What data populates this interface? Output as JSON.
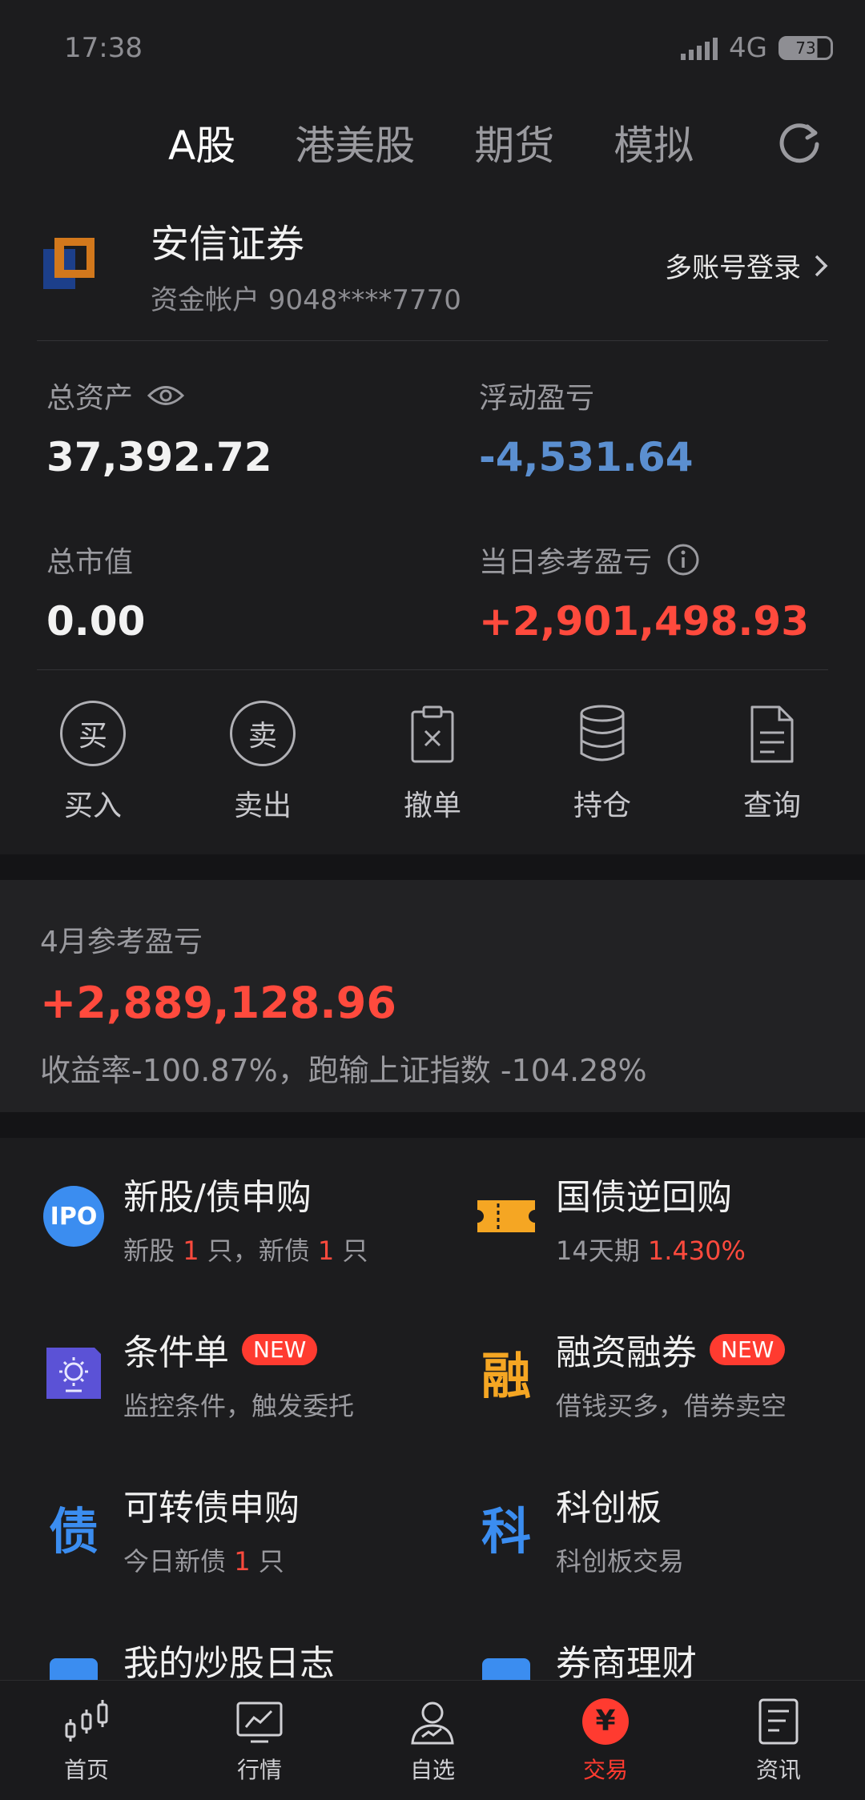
{
  "status": {
    "time": "17:38",
    "network": "4G",
    "battery": "73"
  },
  "tabs": [
    {
      "label": "A股",
      "active": true
    },
    {
      "label": "港美股",
      "active": false
    },
    {
      "label": "期货",
      "active": false
    },
    {
      "label": "模拟",
      "active": false
    }
  ],
  "broker": {
    "name": "安信证券",
    "account": "资金帐户 9048****7770",
    "multi_login": "多账号登录"
  },
  "stats": {
    "total_assets_label": "总资产",
    "total_assets_value": "37,392.72",
    "floating_pl_label": "浮动盈亏",
    "floating_pl_value": "-4,531.64",
    "market_value_label": "总市值",
    "market_value_value": "0.00",
    "daily_pl_label": "当日参考盈亏",
    "daily_pl_value": "+2,901,498.93"
  },
  "actions": [
    {
      "label": "买入",
      "glyph": "买",
      "icon": "buy-icon"
    },
    {
      "label": "卖出",
      "glyph": "卖",
      "icon": "sell-icon"
    },
    {
      "label": "撤单",
      "icon": "clipboard-cancel-icon"
    },
    {
      "label": "持仓",
      "icon": "database-icon"
    },
    {
      "label": "查询",
      "icon": "document-icon"
    }
  ],
  "month": {
    "label": "4月参考盈亏",
    "value": "+2,889,128.96",
    "note": "收益率-100.87%，跑输上证指数 -104.28%"
  },
  "services": {
    "ipo": {
      "icon_text": "IPO",
      "title": "新股/债申购",
      "sub_a": "新股 ",
      "count_a": "1",
      "sub_b": " 只，新债 ",
      "count_b": "1",
      "sub_c": " 只"
    },
    "repo": {
      "title": "国债逆回购",
      "sub_a": "14天期 ",
      "rate": "1.430%"
    },
    "conditional": {
      "title": "条件单",
      "badge": "NEW",
      "sub": "监控条件，触发委托"
    },
    "margin": {
      "glyph": "融",
      "title": "融资融券",
      "badge": "NEW",
      "sub": "借钱买多，借券卖空"
    },
    "bond": {
      "glyph": "债",
      "title": "可转债申购",
      "sub_a": "今日新债 ",
      "count": "1",
      "sub_b": " 只"
    },
    "star": {
      "glyph": "科",
      "title": "科创板",
      "sub": "科创板交易"
    },
    "journal": {
      "title": "我的炒股日志"
    },
    "wealth": {
      "title": "券商理财"
    }
  },
  "nav": [
    {
      "label": "首页",
      "icon": "candlestick-icon",
      "active": false
    },
    {
      "label": "行情",
      "icon": "chart-icon",
      "active": false
    },
    {
      "label": "自选",
      "icon": "user-icon",
      "active": false
    },
    {
      "label": "交易",
      "icon": "yen-icon",
      "glyph": "¥",
      "active": true
    },
    {
      "label": "资讯",
      "icon": "news-icon",
      "active": false
    }
  ],
  "colors": {
    "accent": "#ff3b30",
    "loss_blue": "#5b8fd0",
    "orange": "#f5a623",
    "purple": "#5b52d6"
  }
}
